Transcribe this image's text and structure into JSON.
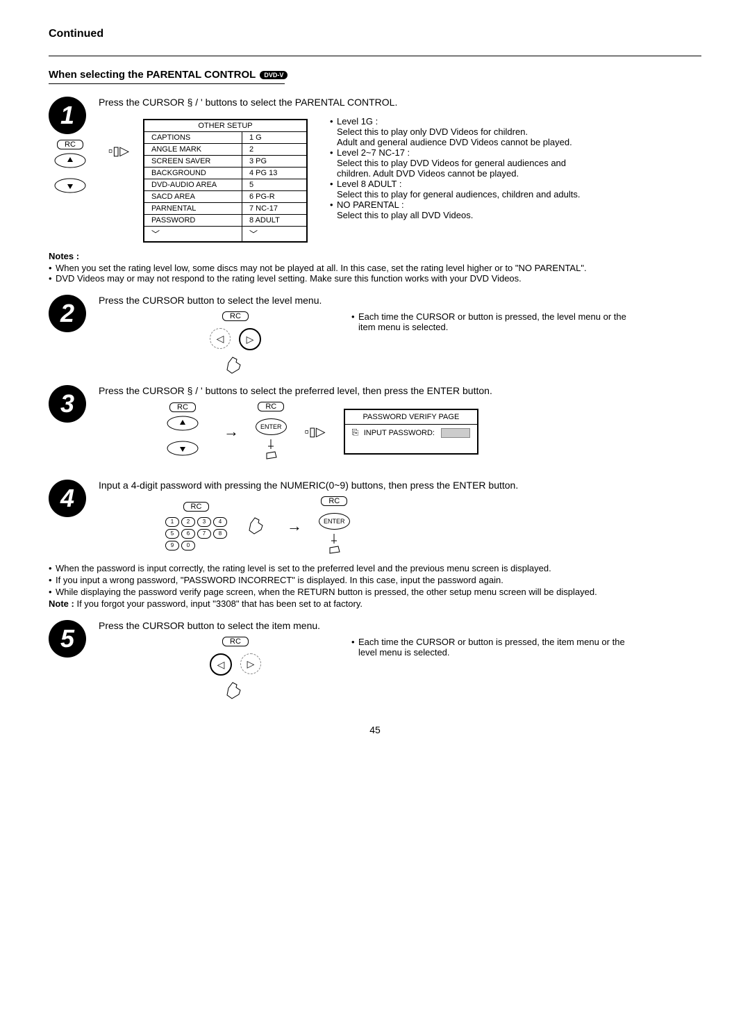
{
  "page_number": "45",
  "header": {
    "continued": "Continued",
    "section_title": "When selecting the PARENTAL CONTROL",
    "badge": "DVD-V"
  },
  "step1": {
    "num": "1",
    "text": "Press the CURSOR  § / '    buttons to select the PARENTAL CONTROL.",
    "rc": "RC",
    "table_title": "OTHER SETUP",
    "rows": [
      [
        "CAPTIONS",
        "1 G"
      ],
      [
        "ANGLE MARK",
        "2"
      ],
      [
        "SCREEN SAVER",
        "3 PG"
      ],
      [
        "BACKGROUND",
        "4 PG 13"
      ],
      [
        "DVD-AUDIO AREA",
        "5"
      ],
      [
        "SACD AREA",
        "6 PG-R"
      ],
      [
        "PARNENTAL",
        "7 NC-17"
      ],
      [
        "PASSWORD",
        "8 ADULT"
      ]
    ]
  },
  "levels": {
    "l1_title": "Level 1G :",
    "l1_a": "Select this to play only DVD Videos for children.",
    "l1_b": "Adult and general audience DVD Videos cannot be played.",
    "l2_title": "Level 2~7 NC-17 :",
    "l2_a": "Select this to play DVD Videos for general audiences and children. Adult DVD Videos cannot be played.",
    "l8_title": "Level 8 ADULT :",
    "l8_a": "Select this to play for general audiences, children and adults.",
    "no_title": "NO PARENTAL :",
    "no_a": "Select this to play all DVD Videos."
  },
  "notes1": {
    "heading": "Notes :",
    "n1": "When you set the rating level low, some discs may not be played at all. In this case, set the rating level higher or to \"NO PARENTAL\".",
    "n2": "DVD Videos may or may not respond to the rating level setting. Make sure this function works with your DVD Videos."
  },
  "step2": {
    "num": "2",
    "text": "Press the CURSOR        button to select the level menu.",
    "rc": "RC",
    "side": "Each time the CURSOR        or        button is pressed, the level menu or the item menu is selected."
  },
  "step3": {
    "num": "3",
    "text": "Press the CURSOR  § / '    buttons to select the preferred level, then press the ENTER button.",
    "rc": "RC",
    "enter": "ENTER",
    "pw_title": "PASSWORD VERIFY PAGE",
    "pw_label": "INPUT PASSWORD:"
  },
  "step4": {
    "num": "4",
    "text": "Input a 4-digit password with pressing the NUMERIC(0~9) buttons, then press the ENTER button.",
    "rc": "RC",
    "enter": "ENTER"
  },
  "after4": {
    "a": "When the password is input correctly, the rating level is set to the preferred level and the previous menu screen is displayed.",
    "b": "If you input a wrong password, \"PASSWORD INCORRECT\" is displayed. In this case, input the password again.",
    "c": "While displaying the password verify page screen, when the RETURN button is pressed, the other setup menu screen will be displayed.",
    "note_label": "Note :",
    "note_text": " If you forgot your password, input \"3308\" that has been set to at factory."
  },
  "step5": {
    "num": "5",
    "text": "Press the CURSOR        button to select the item menu.",
    "rc": "RC",
    "side": "Each time the CURSOR        or        button is pressed, the item menu or the level menu is selected."
  }
}
